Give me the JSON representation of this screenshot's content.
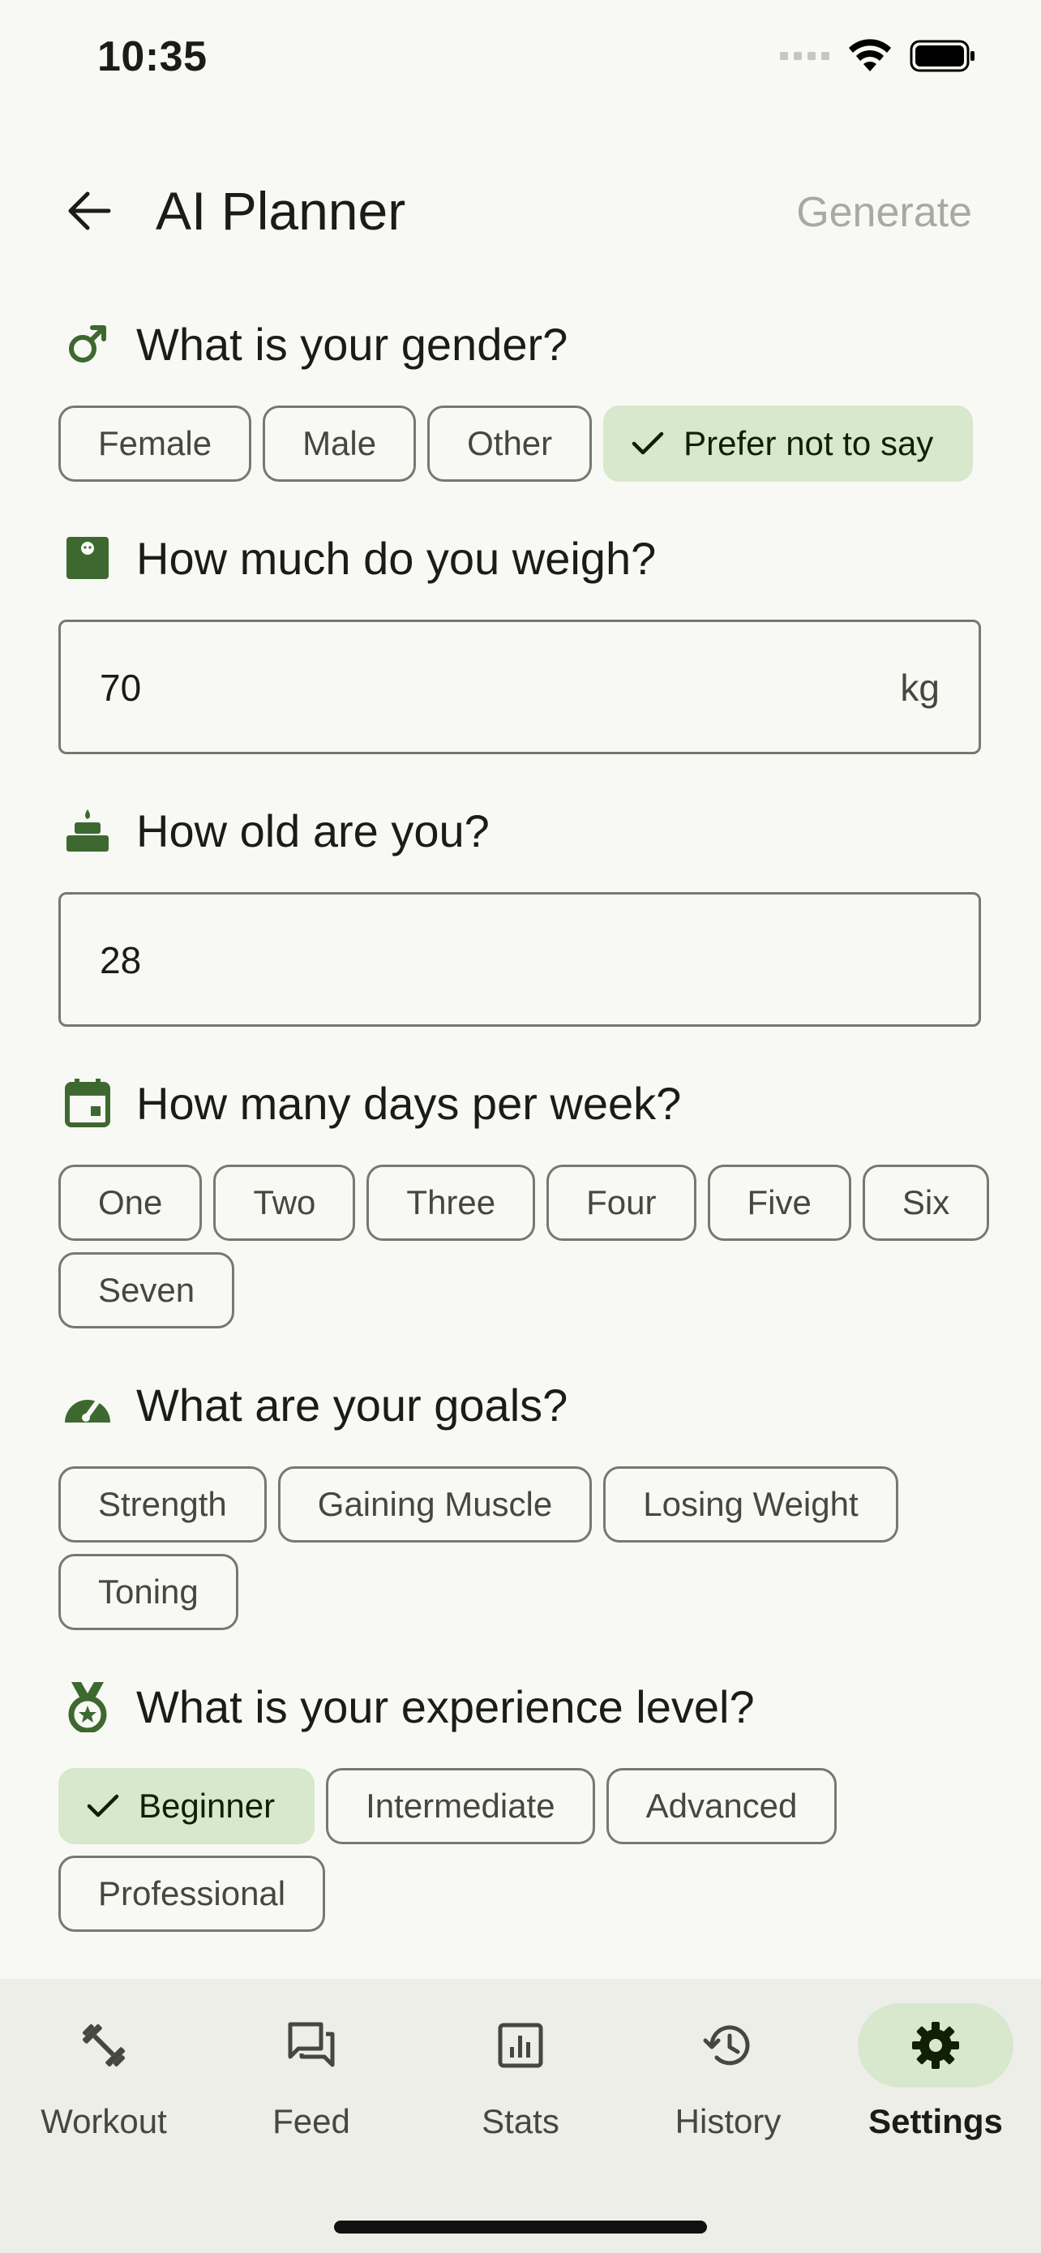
{
  "status": {
    "time": "10:35"
  },
  "app_bar": {
    "title": "AI Planner",
    "generate_label": "Generate"
  },
  "colors": {
    "accent": "#3d6930",
    "chip_selected_bg": "#d7e8cd",
    "outline": "#75796f",
    "disabled_text": "#a7aaa3"
  },
  "gender": {
    "question": "What is your gender?",
    "icon": "male-icon",
    "options": [
      "Female",
      "Male",
      "Other",
      "Prefer not to say"
    ],
    "selected": "Prefer not to say"
  },
  "weight": {
    "question": "How much do you weigh?",
    "icon": "scale-icon",
    "value": "70",
    "unit": "kg"
  },
  "age": {
    "question": "How old are you?",
    "icon": "cake-icon",
    "value": "28"
  },
  "days": {
    "question": "How many days per week?",
    "icon": "calendar-icon",
    "options": [
      "One",
      "Two",
      "Three",
      "Four",
      "Five",
      "Six",
      "Seven"
    ]
  },
  "goals": {
    "question": "What are your goals?",
    "icon": "speedometer-icon",
    "options": [
      "Strength",
      "Gaining Muscle",
      "Losing Weight",
      "Toning"
    ]
  },
  "experience": {
    "question": "What is your experience level?",
    "icon": "medal-icon",
    "options": [
      "Beginner",
      "Intermediate",
      "Advanced",
      "Professional"
    ],
    "selected": "Beginner"
  },
  "nav": {
    "items": [
      {
        "label": "Workout",
        "icon": "dumbbell-icon"
      },
      {
        "label": "Feed",
        "icon": "forum-icon"
      },
      {
        "label": "Stats",
        "icon": "chart-icon"
      },
      {
        "label": "History",
        "icon": "history-icon"
      },
      {
        "label": "Settings",
        "icon": "gear-icon"
      }
    ],
    "active": "Settings"
  }
}
